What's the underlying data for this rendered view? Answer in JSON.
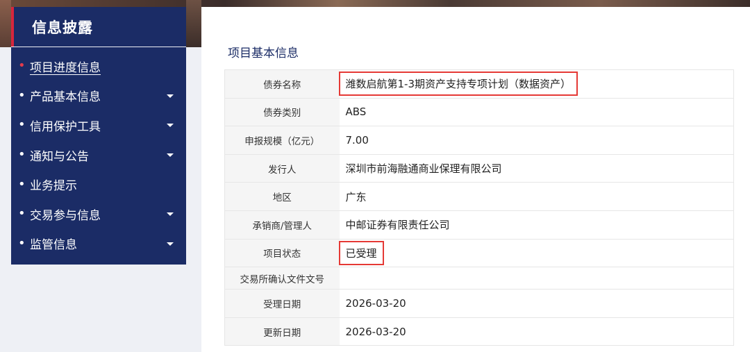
{
  "sidebar": {
    "title": "信息披露",
    "items": [
      {
        "label": "项目进度信息",
        "active": true,
        "has_submenu": false
      },
      {
        "label": "产品基本信息",
        "active": false,
        "has_submenu": true
      },
      {
        "label": "信用保护工具",
        "active": false,
        "has_submenu": true
      },
      {
        "label": "通知与公告",
        "active": false,
        "has_submenu": true
      },
      {
        "label": "业务提示",
        "active": false,
        "has_submenu": false
      },
      {
        "label": "交易参与信息",
        "active": false,
        "has_submenu": true
      },
      {
        "label": "监管信息",
        "active": false,
        "has_submenu": true
      }
    ],
    "bullet": "•"
  },
  "main": {
    "section_title": "项目基本信息",
    "rows": [
      {
        "key": "债券名称",
        "value": "潍数启航第1-3期资产支持专项计划（数据资产）"
      },
      {
        "key": "债券类别",
        "value": "ABS"
      },
      {
        "key": "申报规模（亿元）",
        "value": "7.00"
      },
      {
        "key": "发行人",
        "value": "深圳市前海融通商业保理有限公司"
      },
      {
        "key": "地区",
        "value": "广东"
      },
      {
        "key": "承销商/管理人",
        "value": "中邮证券有限责任公司"
      },
      {
        "key": "项目状态",
        "value": "已受理"
      },
      {
        "key": "交易所确认文件文号",
        "value": ""
      },
      {
        "key": "受理日期",
        "value": "2026-03-20"
      },
      {
        "key": "更新日期",
        "value": "2026-03-20"
      }
    ]
  },
  "colors": {
    "sidebar_bg": "#1b2c66",
    "accent_red": "#d7263d",
    "highlight_box": "#e53935"
  }
}
